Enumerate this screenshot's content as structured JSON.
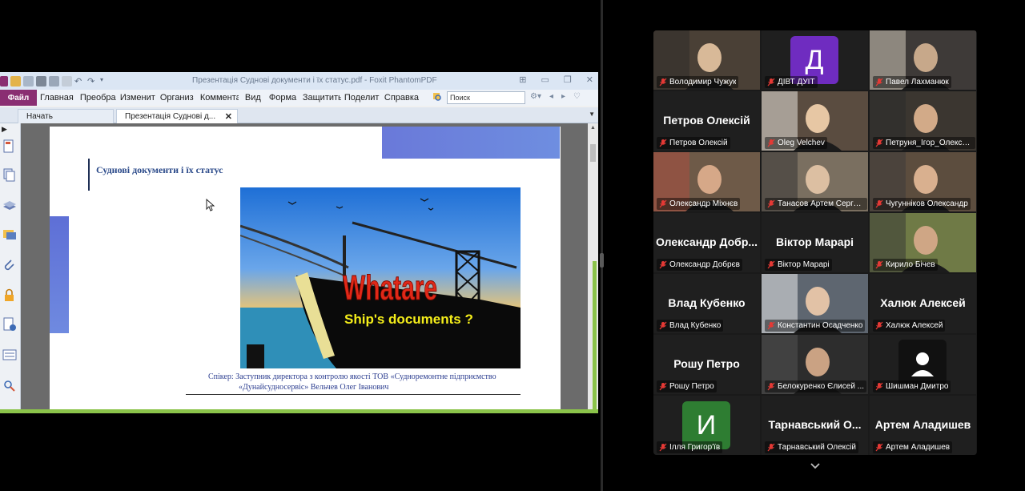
{
  "pdf": {
    "window_title": "Презентація Суднові документи і їх статус.pdf - Foxit PhantomPDF",
    "menu": [
      "Файл",
      "Главная",
      "Преобра",
      "Изменит",
      "Организ",
      "Коммента",
      "Вид",
      "Форма",
      "Защитить",
      "Поделит",
      "Справка"
    ],
    "search_placeholder": "Поиск",
    "tabs": [
      "Начать",
      "Презентація Суднові д..."
    ],
    "slide": {
      "title": "Суднові документи і їх статус",
      "image_text_1": "Whatare",
      "image_text_2": "Ship's documents ?",
      "speaker_line1": "Спікер: Заступник директора з контролю якості ТОВ «Судноремонтне підприємство",
      "speaker_line2": "«Дунайсудносервіс» Вельчев Олег Іванович"
    },
    "colors": {
      "file_tab": "#8a2e72",
      "accent_green": "#8bc34a"
    }
  },
  "participants": [
    {
      "name": "Володимир Чужук",
      "display": "photo",
      "active": false
    },
    {
      "name": "ДІВТ ДУІТ",
      "display": "avatar",
      "initial": "Д",
      "color": "#6f2cc0",
      "active": false
    },
    {
      "name": "Павел Лахманюк",
      "display": "photo",
      "active": false
    },
    {
      "name": "Петров Олексій",
      "display": "name",
      "big_name": "Петров Олексій",
      "active": false
    },
    {
      "name": "Oleg Velchev",
      "display": "photo",
      "active": true
    },
    {
      "name": "Петруня_Ігор_Олекса...",
      "display": "photo",
      "active": false
    },
    {
      "name": "Олександр Міхнєв",
      "display": "photo",
      "active": false
    },
    {
      "name": "Танасов Артем Сергее...",
      "display": "photo",
      "active": false
    },
    {
      "name": "Чугунніков Олександр",
      "display": "photo",
      "active": false
    },
    {
      "name": "Олександр Добрєв",
      "display": "name",
      "big_name": "Олександр Добр...",
      "active": false
    },
    {
      "name": "Віктор Марарі",
      "display": "name",
      "big_name": "Віктор Марарі",
      "active": false
    },
    {
      "name": "Кирило Бічев",
      "display": "photo",
      "active": false
    },
    {
      "name": "Влад Кубенко",
      "display": "name",
      "big_name": "Влад Кубенко",
      "active": false
    },
    {
      "name": "Константин Осадченко",
      "display": "photo",
      "active": false
    },
    {
      "name": "Халюк Алексей",
      "display": "name",
      "big_name": "Халюк Алексей",
      "active": false
    },
    {
      "name": "Рошу Петро",
      "display": "name",
      "big_name": "Рошу Петро",
      "active": false
    },
    {
      "name": "Белокуренко Єлисей ...",
      "display": "photo",
      "active": false
    },
    {
      "name": "Шишман Дмитро",
      "display": "avatar",
      "initial": "",
      "color": "#ffffff",
      "active": false
    },
    {
      "name": "Ілля Григор'їв",
      "display": "avatar",
      "initial": "И",
      "color": "#2e7d32",
      "active": false
    },
    {
      "name": "Тарнавський Олексій",
      "display": "name",
      "big_name": "Тарнавський О...",
      "active": false
    },
    {
      "name": "Артем Аладишев",
      "display": "name",
      "big_name": "Артем Аладишев",
      "active": false
    }
  ],
  "icons": {
    "muted": "mic-muted-icon",
    "more": "chevron-down-icon"
  }
}
